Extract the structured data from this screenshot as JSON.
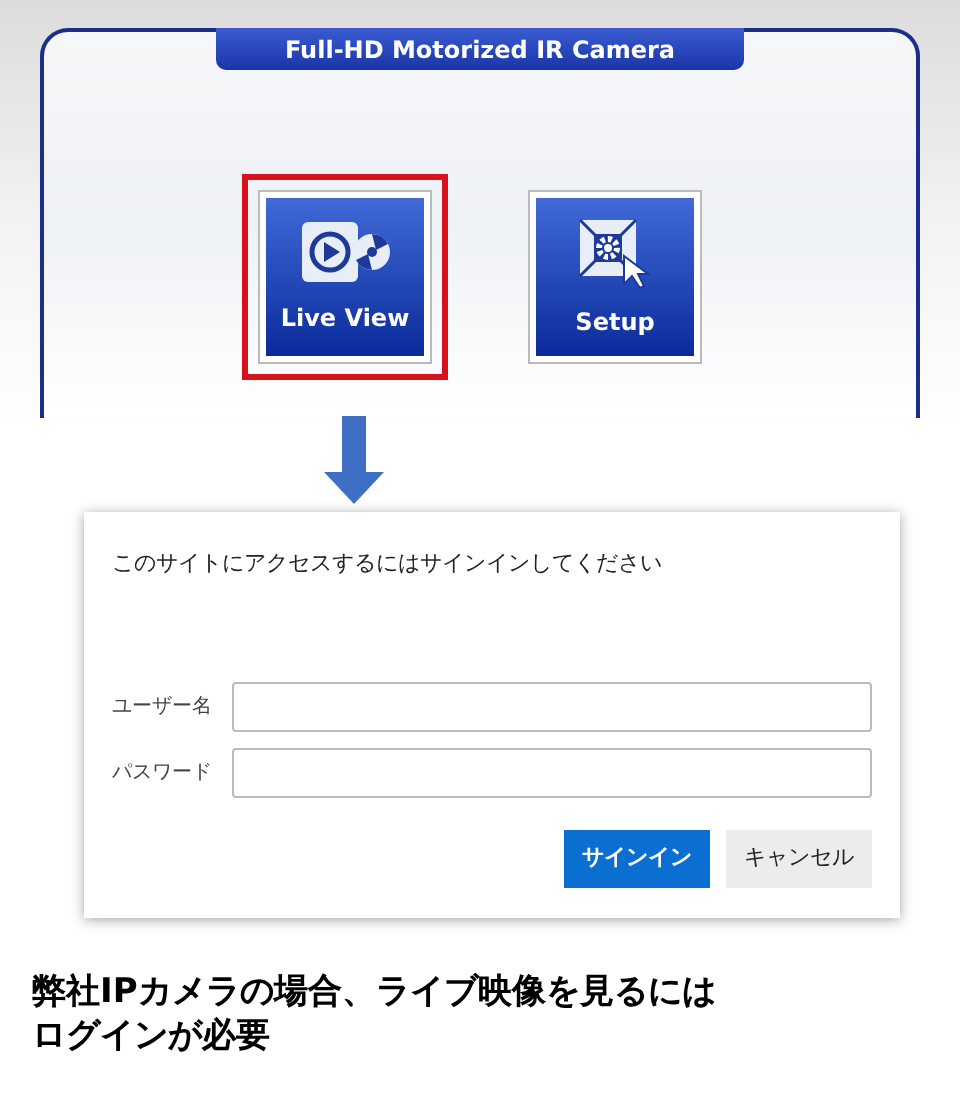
{
  "camera_page": {
    "title": "Full-HD Motorized IR Camera",
    "tiles": [
      {
        "kind": "live",
        "label": "Live View",
        "selected": true
      },
      {
        "kind": "setup",
        "label": "Setup",
        "selected": false
      }
    ]
  },
  "dialog": {
    "title": "このサイトにアクセスするにはサインインしてください",
    "fields": [
      {
        "label": "ユーザー名"
      },
      {
        "label": "パスワード"
      }
    ],
    "buttons": [
      {
        "kind": "primary",
        "label": "サインイン"
      },
      {
        "kind": "secondary",
        "label": "キャンセル"
      }
    ]
  },
  "caption_lines": [
    "弊社IPカメラの場合、ライブ映像を見るには",
    "ログインが必要"
  ]
}
